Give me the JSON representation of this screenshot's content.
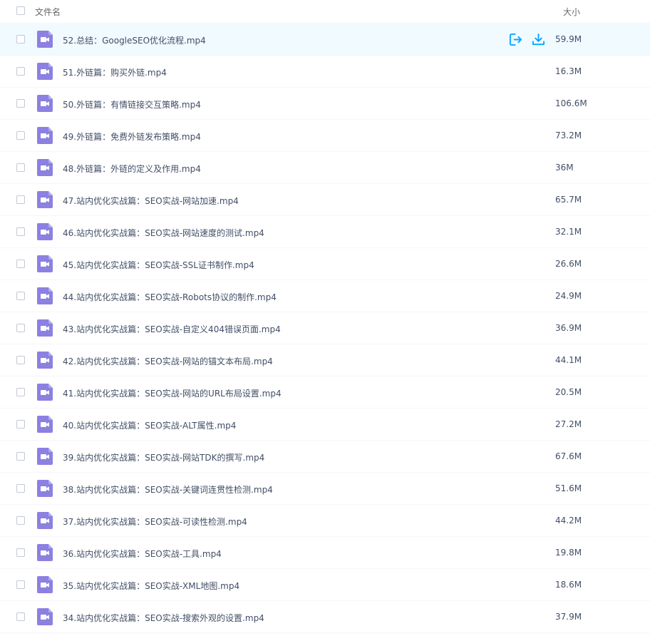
{
  "header": {
    "name_label": "文件名",
    "size_label": "大小"
  },
  "colors": {
    "icon_purple": "#8c80e0",
    "action_blue": "#06a7ff",
    "row_highlight": "#f0faff"
  },
  "files": [
    {
      "name": "52.总结：GoogleSEO优化流程.mp4",
      "size": "59.9M"
    },
    {
      "name": "51.外链篇：购买外链.mp4",
      "size": "16.3M"
    },
    {
      "name": "50.外链篇：有情链接交互策略.mp4",
      "size": "106.6M"
    },
    {
      "name": "49.外链篇：免费外链发布策略.mp4",
      "size": "73.2M"
    },
    {
      "name": "48.外链篇：外链的定义及作用.mp4",
      "size": "36M"
    },
    {
      "name": "47.站内优化实战篇：SEO实战-网站加速.mp4",
      "size": "65.7M"
    },
    {
      "name": "46.站内优化实战篇：SEO实战-网站速度的测试.mp4",
      "size": "32.1M"
    },
    {
      "name": "45.站内优化实战篇：SEO实战-SSL证书制作.mp4",
      "size": "26.6M"
    },
    {
      "name": "44.站内优化实战篇：SEO实战-Robots协议的制作.mp4",
      "size": "24.9M"
    },
    {
      "name": "43.站内优化实战篇：SEO实战-自定义404错误页面.mp4",
      "size": "36.9M"
    },
    {
      "name": "42.站内优化实战篇：SEO实战-网站的锚文本布局.mp4",
      "size": "44.1M"
    },
    {
      "name": "41.站内优化实战篇：SEO实战-网站的URL布局设置.mp4",
      "size": "20.5M"
    },
    {
      "name": "40.站内优化实战篇：SEO实战-ALT属性.mp4",
      "size": "27.2M"
    },
    {
      "name": "39.站内优化实战篇：SEO实战-网站TDK的撰写.mp4",
      "size": "67.6M"
    },
    {
      "name": "38.站内优化实战篇：SEO实战-关键词连贯性检测.mp4",
      "size": "51.6M"
    },
    {
      "name": "37.站内优化实战篇：SEO实战-可读性检测.mp4",
      "size": "44.2M"
    },
    {
      "name": "36.站内优化实战篇：SEO实战-工具.mp4",
      "size": "19.8M"
    },
    {
      "name": "35.站内优化实战篇：SEO实战-XML地图.mp4",
      "size": "18.6M"
    },
    {
      "name": "34.站内优化实战篇：SEO实战-搜索外观的设置.mp4",
      "size": "37.9M"
    }
  ]
}
